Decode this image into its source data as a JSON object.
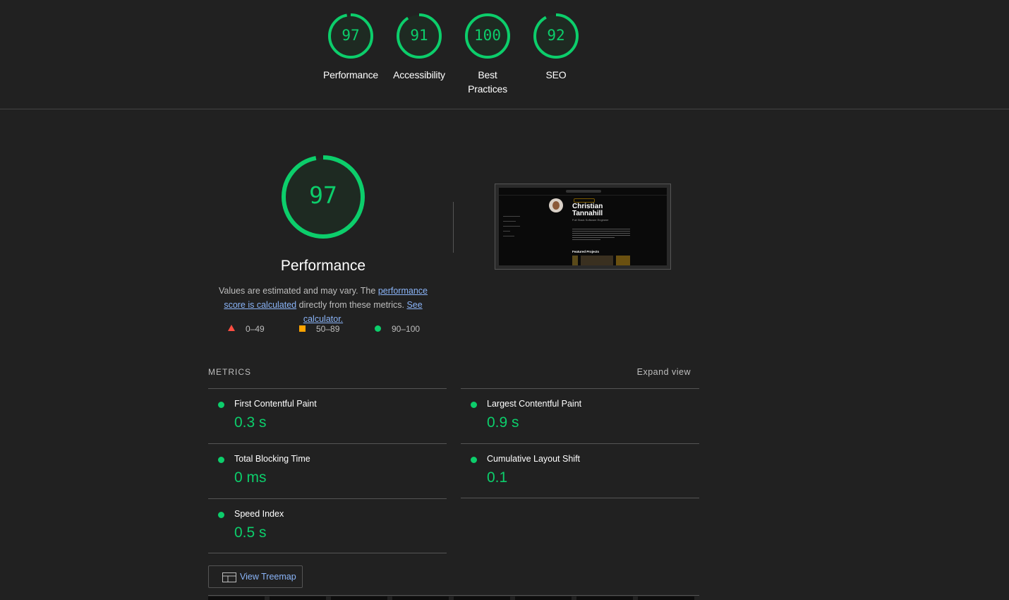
{
  "top_scores": [
    {
      "score": "97",
      "label": "Performance",
      "fraction": 0.97
    },
    {
      "score": "91",
      "label": "Accessibility",
      "fraction": 0.91
    },
    {
      "score": "100",
      "label": "Best Practices",
      "fraction": 1.0
    },
    {
      "score": "92",
      "label": "SEO",
      "fraction": 0.92
    }
  ],
  "performance": {
    "score": "97",
    "fraction": 0.97,
    "title": "Performance",
    "desc_prefix": "Values are estimated and may vary. The ",
    "link_score": "performance score is calculated",
    "desc_mid": " directly from these metrics. ",
    "link_calculator": "See calculator."
  },
  "legend": {
    "fail": "0–49",
    "average": "50–89",
    "pass": "90–100"
  },
  "screenshot": {
    "name_line1": "Christian",
    "name_line2": "Tannahill",
    "subtitle": "Full Stack Software Engineer",
    "section": "Featured Projects"
  },
  "metrics": {
    "title": "METRICS",
    "expand": "Expand view",
    "items": [
      {
        "name": "First Contentful Paint",
        "value": "0.3 s"
      },
      {
        "name": "Largest Contentful Paint",
        "value": "0.9 s"
      },
      {
        "name": "Total Blocking Time",
        "value": "0 ms"
      },
      {
        "name": "Cumulative Layout Shift",
        "value": "0.1"
      },
      {
        "name": "Speed Index",
        "value": "0.5 s"
      }
    ]
  },
  "treemap_label": "View Treemap",
  "colors": {
    "pass": "#0cce6b",
    "average": "#ffa400",
    "fail": "#ff4e42",
    "link": "#8ab4f8",
    "background": "#212121"
  }
}
